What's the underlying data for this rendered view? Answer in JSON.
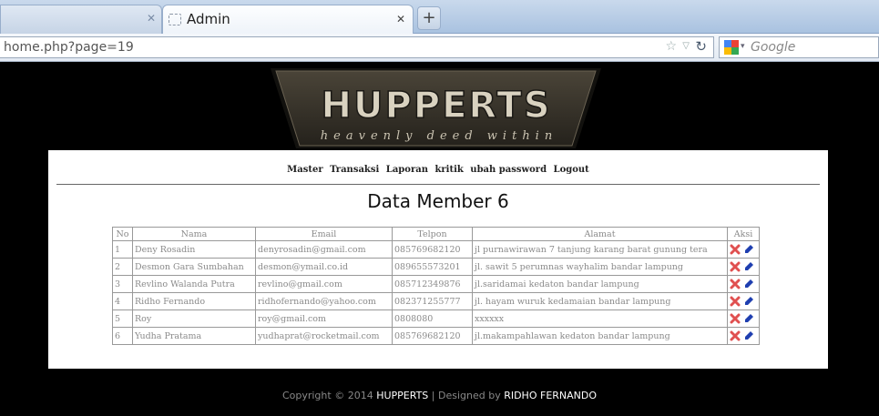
{
  "browser": {
    "tabs": [
      {
        "label": ""
      },
      {
        "label": "Admin"
      }
    ],
    "url": "home.php?page=19",
    "search_engine": "Google"
  },
  "logo": {
    "title": "HUPPERTS",
    "tagline": "heavenly deed within"
  },
  "menu": {
    "items": [
      "Master",
      "Transaksi",
      "Laporan",
      "kritik",
      "ubah password",
      "Logout"
    ]
  },
  "page_title": "Data Member 6",
  "table": {
    "headers": [
      "No",
      "Nama",
      "Email",
      "Telpon",
      "Alamat",
      "Aksi"
    ],
    "rows": [
      {
        "no": "1",
        "nama": "Deny Rosadin",
        "email": "denyrosadin@gmail.com",
        "telpon": "085769682120",
        "alamat": "jl purnawirawan 7 tanjung karang barat gunung tera"
      },
      {
        "no": "2",
        "nama": "Desmon Gara Sumbahan",
        "email": "desmon@ymail.co.id",
        "telpon": "089655573201",
        "alamat": "jl. sawit 5 perumnas wayhalim bandar lampung"
      },
      {
        "no": "3",
        "nama": "Revlino Walanda Putra",
        "email": "revlino@gmail.com",
        "telpon": "085712349876",
        "alamat": "jl.saridamai kedaton bandar lampung"
      },
      {
        "no": "4",
        "nama": "Ridho Fernando",
        "email": "ridhofernando@yahoo.com",
        "telpon": "082371255777",
        "alamat": "jl. hayam wuruk kedamaian bandar lampung"
      },
      {
        "no": "5",
        "nama": "Roy",
        "email": "roy@gmail.com",
        "telpon": "0808080",
        "alamat": "xxxxxx"
      },
      {
        "no": "6",
        "nama": "Yudha Pratama",
        "email": "yudhaprat@rocketmail.com",
        "telpon": "085769682120",
        "alamat": "jl.makampahlawan kedaton bandar lampung"
      }
    ]
  },
  "footer": {
    "prefix": "Copyright © 2014 ",
    "brand": "HUPPERTS",
    "middle": " | Designed by ",
    "author": "RIDHO FERNANDO"
  },
  "icons": {
    "delete": "delete-icon",
    "edit": "edit-icon",
    "tab_close": "close-icon",
    "new_tab": "plus-icon",
    "bookmark": "star-icon",
    "reload": "reload-icon"
  },
  "colors": {
    "page_bg": "#000000",
    "content_bg": "#ffffff",
    "logo_text": "#d9d2c0",
    "delete": "#e05050",
    "edit": "#1f3fb0"
  }
}
